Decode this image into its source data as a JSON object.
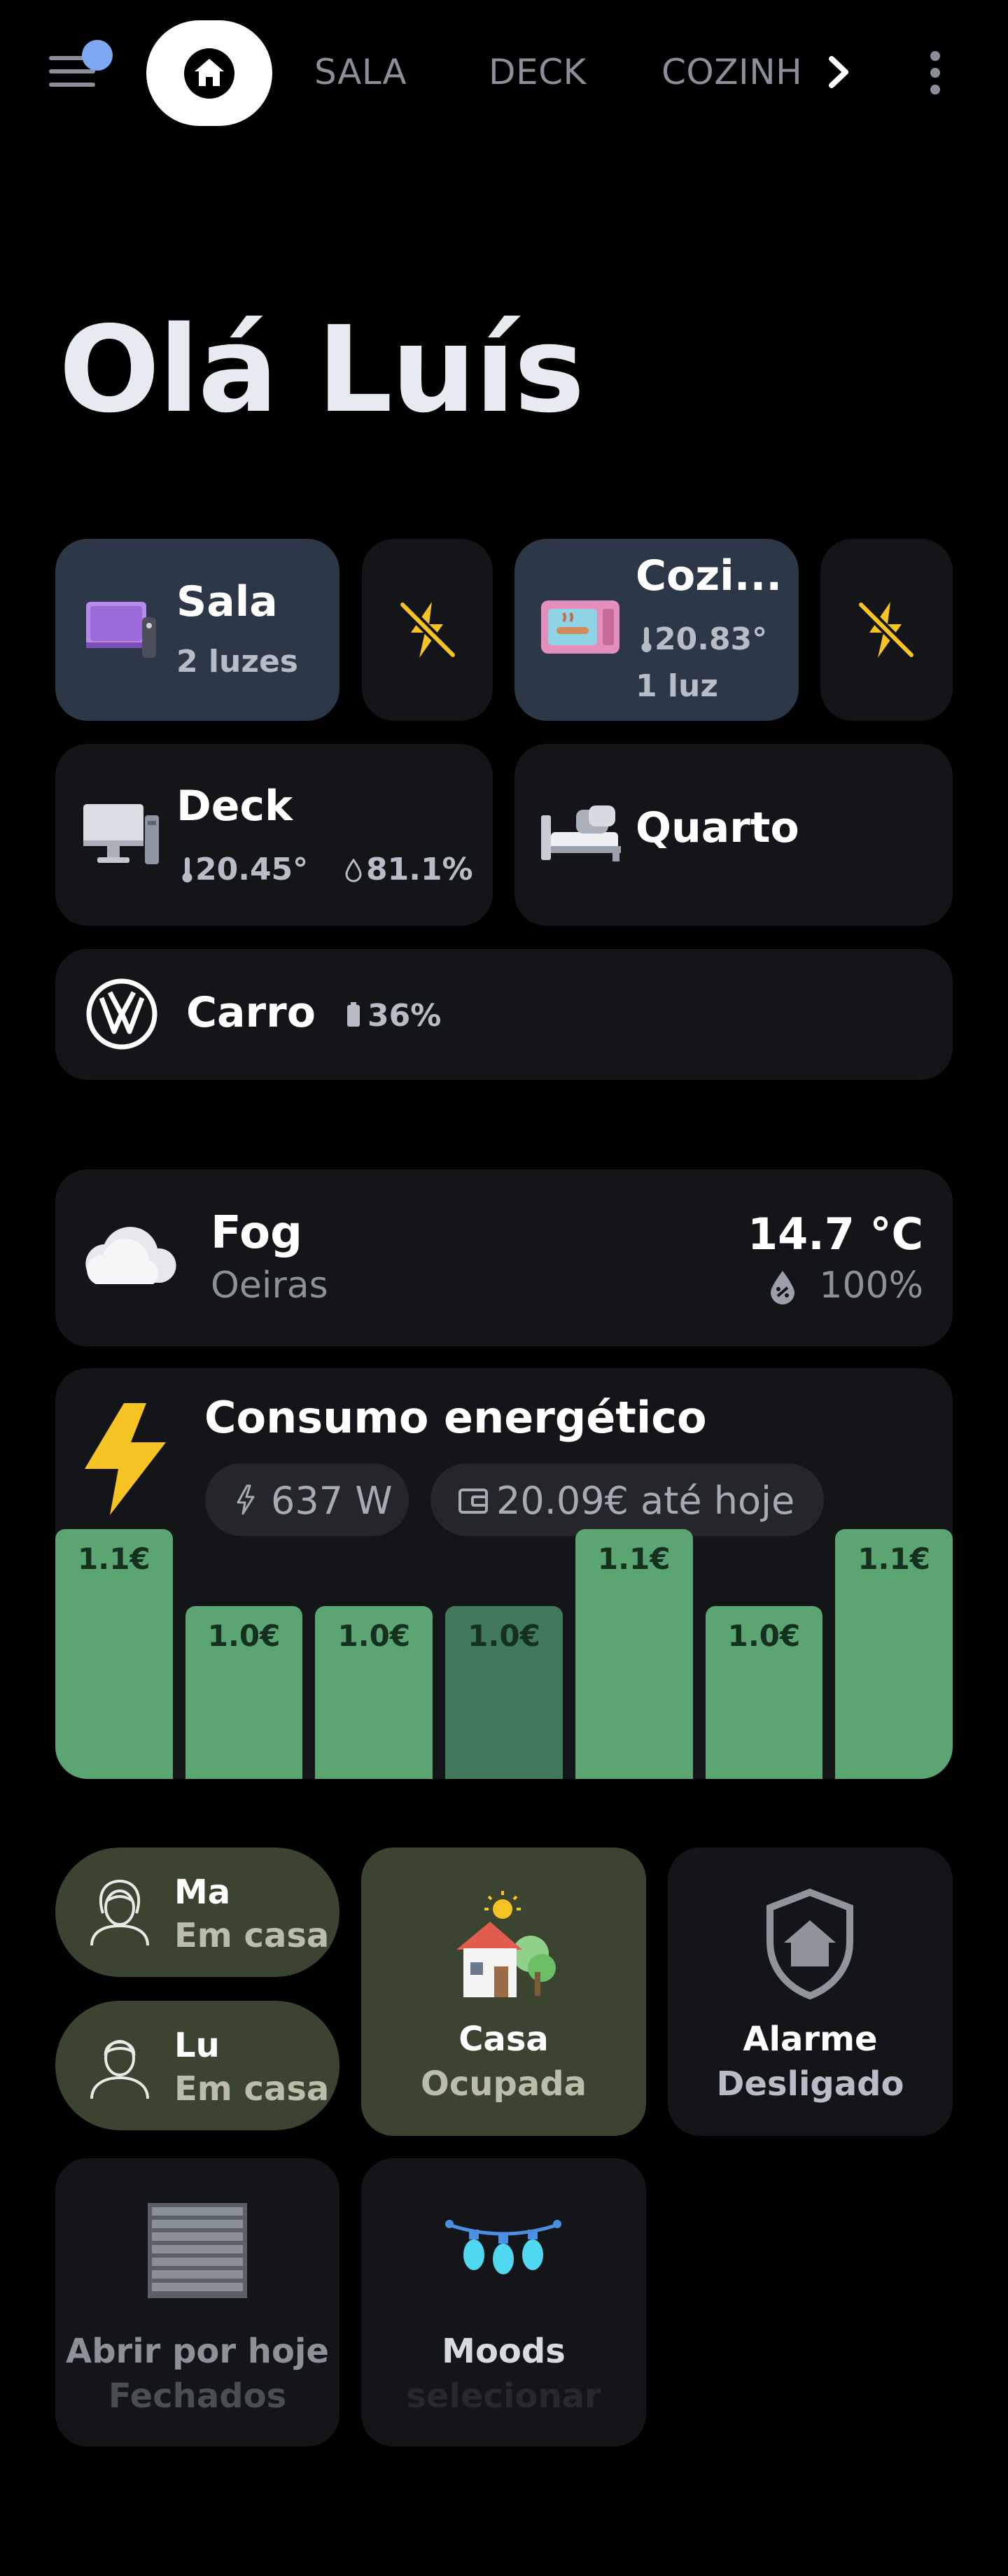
{
  "nav": {
    "tabs": [
      "SALA",
      "DECK",
      "COZINH"
    ]
  },
  "greeting": "Olá Luís",
  "rooms": {
    "sala": {
      "name": "Sala",
      "detail": "2 luzes"
    },
    "cozinha": {
      "name": "Cozi...",
      "temp": "20.83°",
      "detail": "1 luz"
    },
    "deck": {
      "name": "Deck",
      "temp": "20.45°",
      "humidity": "81.1%"
    },
    "quarto": {
      "name": "Quarto"
    },
    "carro": {
      "name": "Carro",
      "battery": "36%"
    }
  },
  "weather": {
    "condition": "Fog",
    "location": "Oeiras",
    "temperature": "14.7 °C",
    "humidity": "100%"
  },
  "energy": {
    "title": "Consumo energético",
    "power": "637 W",
    "cost": "20.09€ até hoje",
    "bars": [
      {
        "label": "1.1€",
        "value": 1.1
      },
      {
        "label": "1.0€",
        "value": 1.0
      },
      {
        "label": "1.0€",
        "value": 1.0
      },
      {
        "label": "1.0€",
        "value": 1.0
      },
      {
        "label": "1.1€",
        "value": 1.1
      },
      {
        "label": "1.0€",
        "value": 1.0
      },
      {
        "label": "1.1€",
        "value": 1.1
      }
    ]
  },
  "people": [
    {
      "name": "Ma",
      "status": "Em casa"
    },
    {
      "name": "Lu",
      "status": "Em casa"
    }
  ],
  "casa": {
    "title": "Casa",
    "status": "Ocupada"
  },
  "alarme": {
    "title": "Alarme",
    "status": "Desligado"
  },
  "blinds": {
    "title": "Abrir por hoje",
    "status": "Fechados"
  },
  "moods": {
    "title": "Moods",
    "status": "selecionar"
  },
  "colors": {
    "accent_blue": "#2c3748",
    "olive": "#3b4430",
    "bar_green": "#5ba572",
    "bolt_yellow": "#f6c324"
  }
}
